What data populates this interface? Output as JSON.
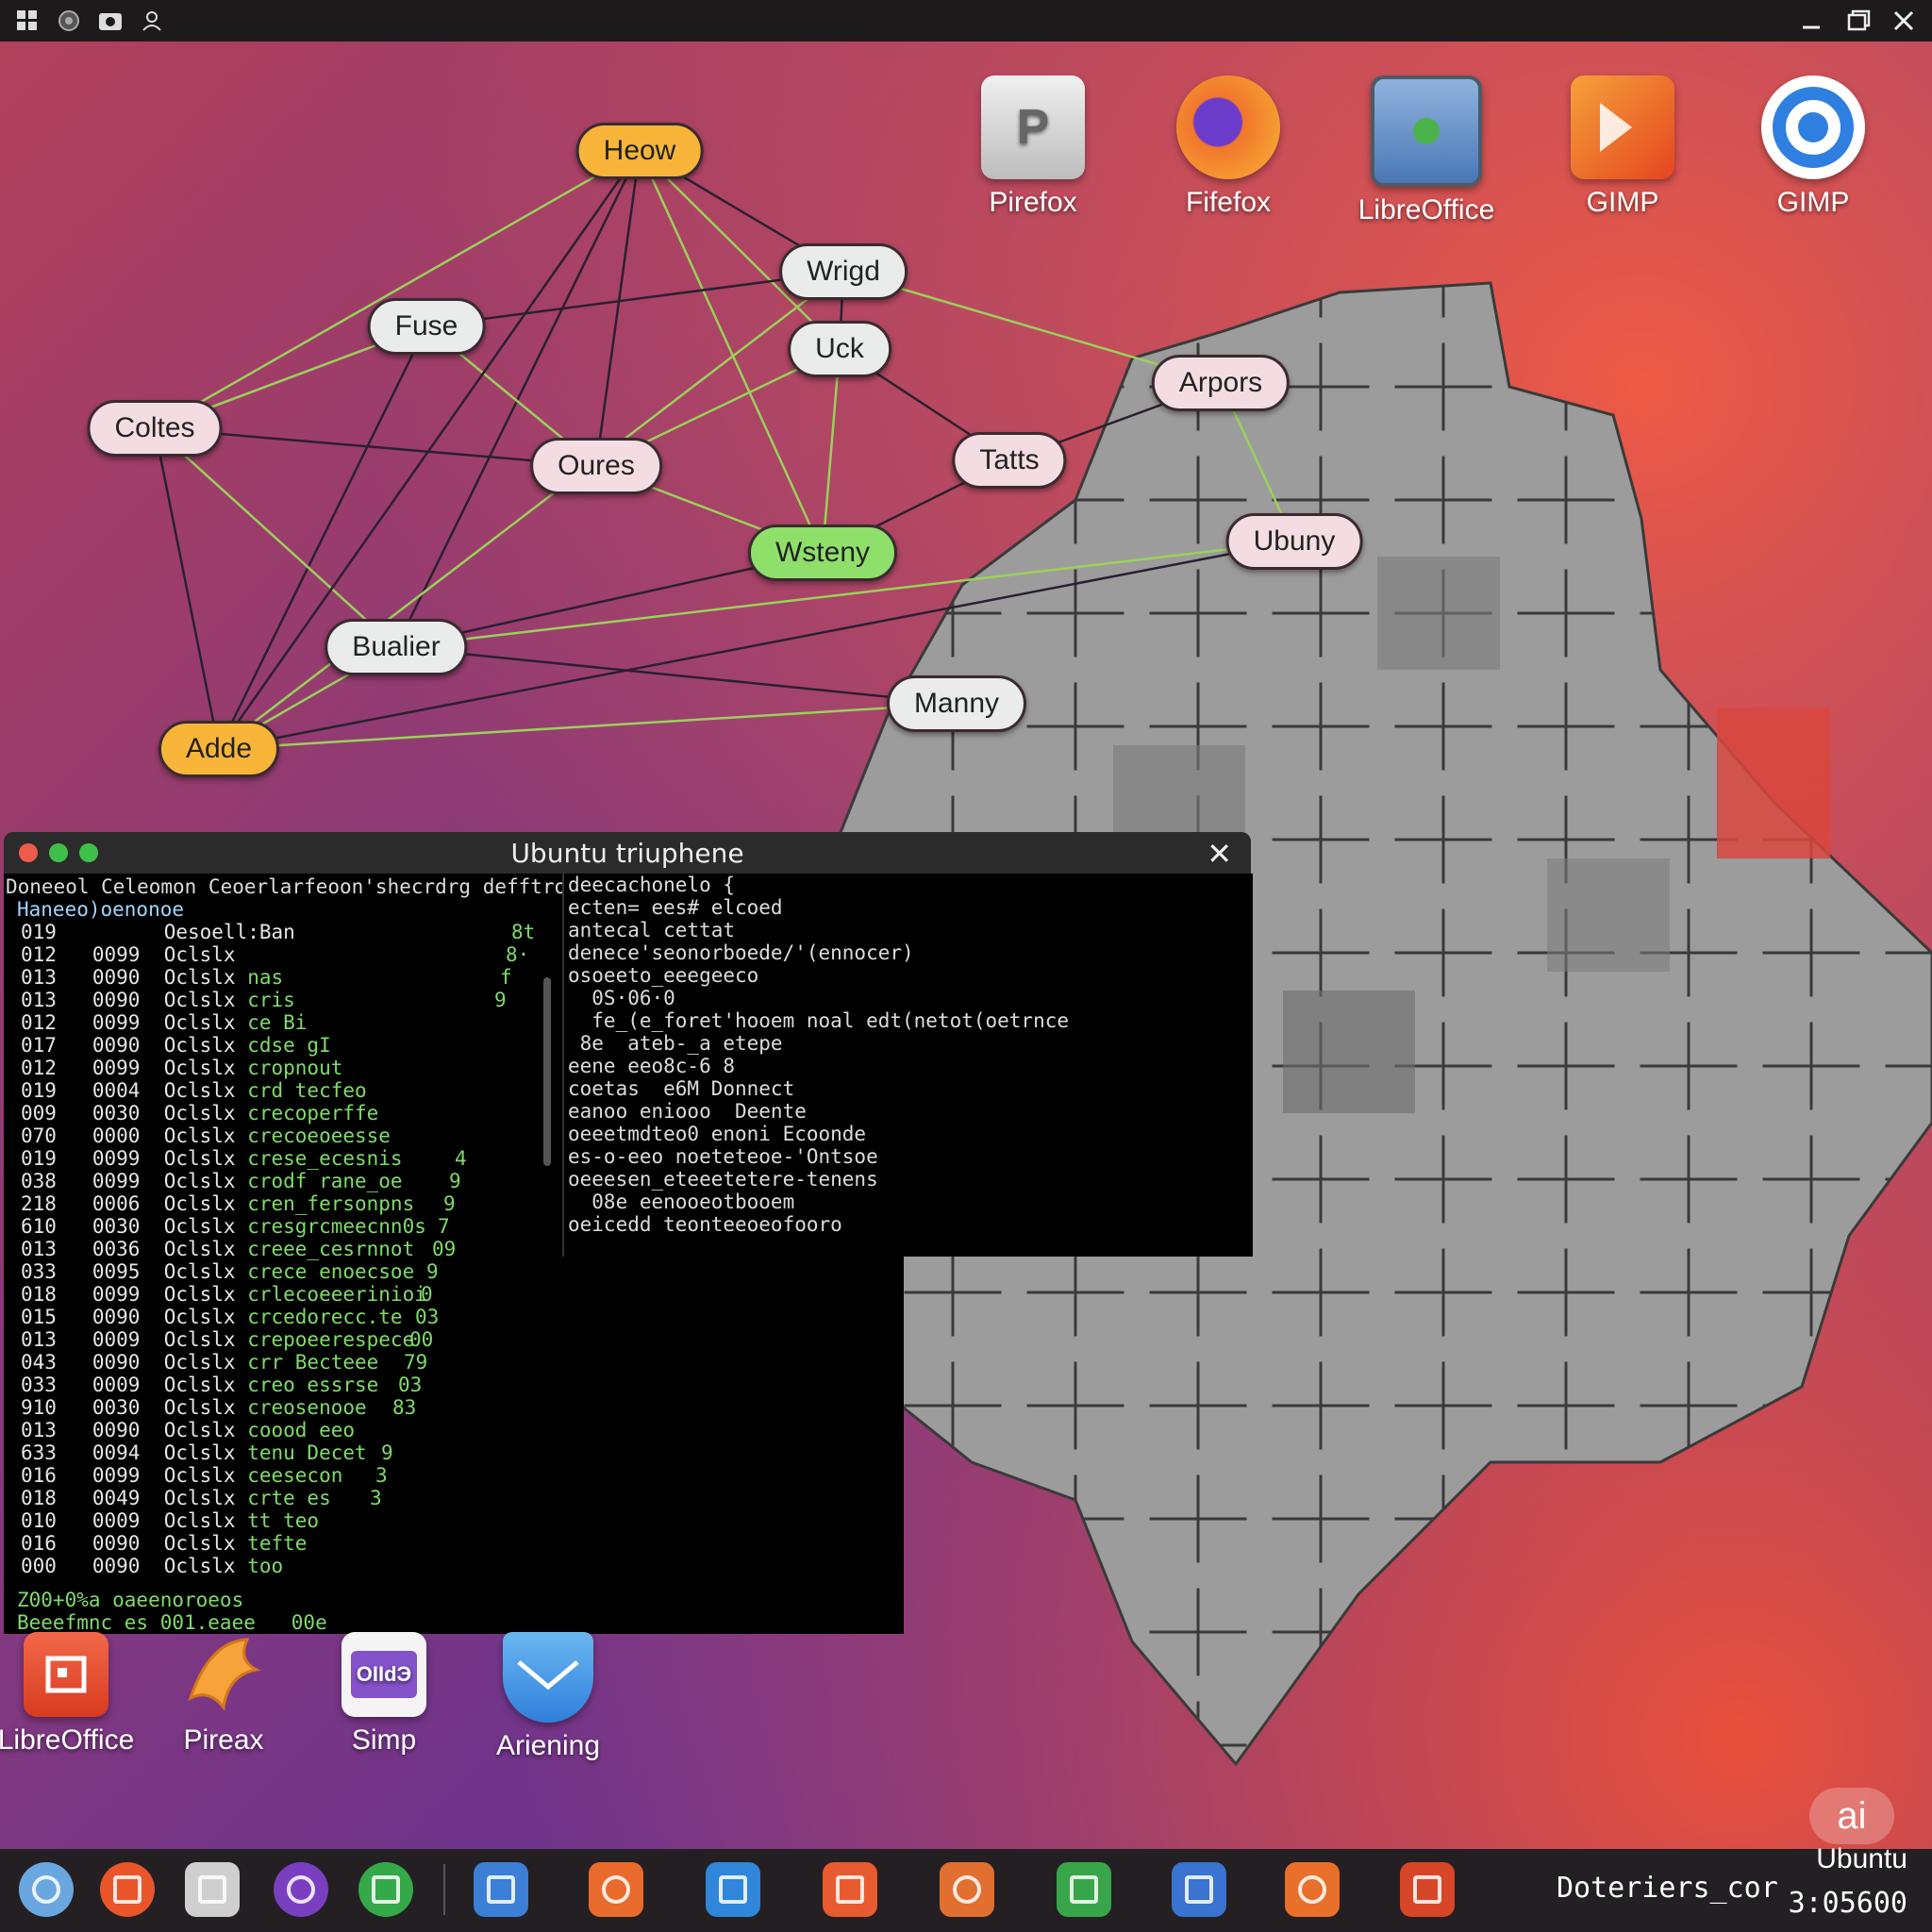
{
  "top_bar": {
    "window_controls": [
      "minimize-icon",
      "maximize-icon",
      "close-icon"
    ]
  },
  "desktop_icons_top": [
    {
      "label": "Pirefox",
      "icon": "document-icon",
      "color": "#d9d9d9"
    },
    {
      "label": "Fifefox",
      "icon": "firefox-icon",
      "color": "#f2762e"
    },
    {
      "label": "LibreOffice",
      "icon": "monitor-icon",
      "color": "#5c8fc9"
    },
    {
      "label": "GIMP",
      "icon": "gimp-icon",
      "color": "#ef5a24"
    },
    {
      "label": "GIMP",
      "icon": "circle-app-icon",
      "color": "#2f7fe0"
    }
  ],
  "graph": {
    "nodes": [
      {
        "id": "heow",
        "label": "Heow"
      },
      {
        "id": "wrigd",
        "label": "Wrigd"
      },
      {
        "id": "fuse",
        "label": "Fuse"
      },
      {
        "id": "uck",
        "label": "Uck"
      },
      {
        "id": "arpors",
        "label": "Arpors"
      },
      {
        "id": "coltes",
        "label": "Coltes"
      },
      {
        "id": "oures",
        "label": "Oures"
      },
      {
        "id": "tatts",
        "label": "Tatts"
      },
      {
        "id": "wsteny",
        "label": "Wsteny"
      },
      {
        "id": "ubuntu",
        "label": "Ubuny"
      },
      {
        "id": "bualier",
        "label": "Bualier"
      },
      {
        "id": "manny",
        "label": "Manny"
      },
      {
        "id": "adde",
        "label": "Adde"
      }
    ],
    "edges": [
      [
        "heow",
        "wrigd"
      ],
      [
        "heow",
        "coltes"
      ],
      [
        "heow",
        "oures"
      ],
      [
        "heow",
        "wsteny"
      ],
      [
        "heow",
        "bualier"
      ],
      [
        "heow",
        "uck"
      ],
      [
        "fuse",
        "wrigd"
      ],
      [
        "fuse",
        "coltes"
      ],
      [
        "fuse",
        "adde"
      ],
      [
        "fuse",
        "oures"
      ],
      [
        "coltes",
        "oures"
      ],
      [
        "coltes",
        "bualier"
      ],
      [
        "coltes",
        "adde"
      ],
      [
        "wrigd",
        "arpors"
      ],
      [
        "wrigd",
        "uck"
      ],
      [
        "uck",
        "oures"
      ],
      [
        "uck",
        "tatts"
      ],
      [
        "uck",
        "wsteny"
      ],
      [
        "arpors",
        "tatts"
      ],
      [
        "arpors",
        "ubuntu"
      ],
      [
        "tatts",
        "wsteny"
      ],
      [
        "oures",
        "wsteny"
      ],
      [
        "wsteny",
        "bualier"
      ],
      [
        "ubuntu",
        "bualier"
      ],
      [
        "ubuntu",
        "adde"
      ],
      [
        "bualier",
        "adde"
      ],
      [
        "bualier",
        "manny"
      ],
      [
        "manny",
        "adde"
      ],
      [
        "heow",
        "adde"
      ],
      [
        "wrigd",
        "adde"
      ]
    ]
  },
  "terminal": {
    "title": "Ubuntu triuphene",
    "header_line": "Doneeol Celeomon Ceoerlarfeoon'shecrdrg defftroo}",
    "subheader": "Haneeo)oenonoe",
    "left_rows": [
      [
        "019",
        "",
        "Oesoell:Ban",
        ""
      ],
      [
        "012",
        "0099",
        "Oclslx",
        ""
      ],
      [
        "013",
        "0090",
        "Oclslx",
        "nas"
      ],
      [
        "013",
        "0090",
        "Oclslx",
        "cris"
      ],
      [
        "012",
        "0099",
        "Oclslx",
        "ce Bi"
      ],
      [
        "017",
        "0090",
        "Oclslx",
        "cdse gI"
      ],
      [
        "012",
        "0099",
        "Oclslx",
        "cropnout"
      ],
      [
        "019",
        "0004",
        "Oclslx",
        "crd tecfeo"
      ],
      [
        "009",
        "0030",
        "Oclslx",
        "crecoperffe"
      ],
      [
        "070",
        "0000",
        "Oclslx",
        "crecoeoeesse"
      ],
      [
        "019",
        "0099",
        "Oclslx",
        "crese_ecesnis"
      ],
      [
        "038",
        "0099",
        "Oclslx",
        "crodf rane_oe"
      ],
      [
        "218",
        "0006",
        "Oclslx",
        "cren_fersonpns"
      ],
      [
        "610",
        "0030",
        "Oclslx",
        "cresgrcmeecnn0s"
      ],
      [
        "013",
        "0036",
        "Oclslx",
        "creee_cesrnnot"
      ],
      [
        "033",
        "0095",
        "Oclslx",
        "crece enoecsoe"
      ],
      [
        "018",
        "0099",
        "Oclslx",
        "crlecoeeerinioi"
      ],
      [
        "015",
        "0090",
        "Oclslx",
        "crcedorecc.te"
      ],
      [
        "013",
        "0009",
        "Oclslx",
        "crepoeerespece"
      ],
      [
        "043",
        "0090",
        "Oclslx",
        "crr Becteee"
      ],
      [
        "033",
        "0009",
        "Oclslx",
        "creo essrse"
      ],
      [
        "910",
        "0030",
        "Oclslx",
        "creosenooe"
      ],
      [
        "013",
        "0090",
        "Oclslx",
        "coood eeo"
      ],
      [
        "633",
        "0094",
        "Oclslx",
        "tenu Decet"
      ],
      [
        "016",
        "0099",
        "Oclslx",
        "ceesecon"
      ],
      [
        "018",
        "0049",
        "Oclslx",
        "crte es"
      ],
      [
        "010",
        "0009",
        "Oclslx",
        "tt teo"
      ],
      [
        "016",
        "0090",
        "Oclslx",
        "tefte"
      ],
      [
        "000",
        "0090",
        "Oclslx",
        "too"
      ]
    ],
    "left_right_col": [
      "8t",
      "8·",
      "f",
      "9",
      "",
      "",
      "",
      "",
      "",
      "",
      "4",
      "9",
      "9",
      "7",
      "09",
      "9",
      "0",
      "03",
      "00",
      "79",
      "03",
      "83",
      "",
      "9",
      "3",
      "3",
      ""
    ],
    "footer_lines": [
      "Z00+0%a oaeenoroeos",
      "Beeefmnc es 001.eaee   00e"
    ],
    "right_lines": [
      "deecachonelo {",
      "ecten= ees# elcoed",
      "antecal cettat",
      "denece'seonorboede/'(ennocer)",
      "osoeeto_eeegeeco",
      "  0S·06·0",
      "  fe_(e_foret'hooem noal edt(netot(oetrnce",
      " 8e  ateb-_a etepe",
      "eene eeo8c-6 8",
      "coetas  e6M Donnect",
      "eanoo eniooo  Deente",
      "oeeetmdteo0 enoni Ecoonde",
      "es-o-eeo noeteteoe-'Ontsoe",
      "oeeesen_eteeetetere-tenens",
      "  08e eenooeotbooem",
      "oeicedd teonteeoeofooro"
    ]
  },
  "desktop_icons_bottom": [
    {
      "label": "LibreOffice",
      "icon": "libreoffice-icon",
      "color": "#e8502a"
    },
    {
      "label": "Pireax",
      "icon": "bird-icon",
      "color": "#f6a33a"
    },
    {
      "label": "Simp",
      "icon": "simp-icon",
      "color": "#8452c9",
      "text": "OIIdЭ"
    },
    {
      "label": "Ariening",
      "icon": "mail-icon",
      "color": "#3b8de0"
    }
  ],
  "taskbar": {
    "apps": [
      {
        "icon": "chrome-icon",
        "color": "#6aa7e0"
      },
      {
        "icon": "firefox-icon",
        "color": "#e8562a"
      },
      {
        "icon": "document-icon",
        "color": "#cfcfcf"
      },
      {
        "icon": "circle-app-icon",
        "color": "#7a3fc0"
      },
      {
        "icon": "user-icon",
        "color": "#35a84a"
      },
      {
        "icon": "cube-icon",
        "color": "#3b7fd6"
      },
      {
        "icon": "warning-icon",
        "color": "#e86a2c"
      },
      {
        "icon": "crosshair-icon",
        "color": "#2f86da"
      },
      {
        "icon": "ring-icon",
        "color": "#e85a30"
      },
      {
        "icon": "target-icon",
        "color": "#e06f30"
      },
      {
        "icon": "chart-icon",
        "color": "#39a54a"
      },
      {
        "icon": "n-icon",
        "color": "#3a73d0"
      },
      {
        "icon": "page-icon",
        "color": "#e8702a"
      },
      {
        "icon": "presentation-icon",
        "color": "#d8462a"
      }
    ],
    "status_text": "Doteriers_cor",
    "ubuntu_badge": "ai",
    "ubuntu_label": "Ubuntu",
    "clock": "3:05600"
  }
}
